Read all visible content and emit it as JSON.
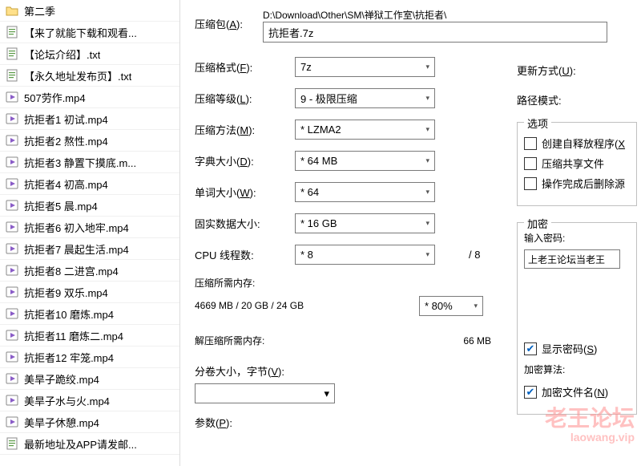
{
  "filelist": {
    "items": [
      {
        "icon": "folder",
        "label": "第二季"
      },
      {
        "icon": "txt",
        "label": "【来了就能下载和观看..."
      },
      {
        "icon": "txt",
        "label": "【论坛介绍】.txt"
      },
      {
        "icon": "txt",
        "label": "【永久地址发布页】.txt"
      },
      {
        "icon": "video",
        "label": "507劳作.mp4"
      },
      {
        "icon": "video",
        "label": "抗拒者1 初试.mp4"
      },
      {
        "icon": "video",
        "label": "抗拒者2 熬性.mp4"
      },
      {
        "icon": "video",
        "label": "抗拒者3 静置下摸底.m..."
      },
      {
        "icon": "video",
        "label": "抗拒者4 初高.mp4"
      },
      {
        "icon": "video",
        "label": "抗拒者5 晨.mp4"
      },
      {
        "icon": "video",
        "label": "抗拒者6 初入地牢.mp4"
      },
      {
        "icon": "video",
        "label": "抗拒者7 晨起生活.mp4"
      },
      {
        "icon": "video",
        "label": "抗拒者8 二进宫.mp4"
      },
      {
        "icon": "video",
        "label": "抗拒者9 双乐.mp4"
      },
      {
        "icon": "video",
        "label": "抗拒者10 磨炼.mp4"
      },
      {
        "icon": "video",
        "label": "抗拒者11 磨炼二.mp4"
      },
      {
        "icon": "video",
        "label": "抗拒者12 牢笼.mp4"
      },
      {
        "icon": "video",
        "label": "美旱子跪绞.mp4"
      },
      {
        "icon": "video",
        "label": "美旱子水与火.mp4"
      },
      {
        "icon": "video",
        "label": "美旱子休憩.mp4"
      },
      {
        "icon": "txt",
        "label": "最新地址及APP请发邮..."
      }
    ]
  },
  "dialog": {
    "archive_label": "压缩包",
    "archive_accel": "A",
    "archive_path": "D:\\Download\\Other\\SM\\禅狱工作室\\抗拒者\\",
    "archive_name": "抗拒者.7z",
    "format_label": "压缩格式",
    "format_accel": "F",
    "format_value": "7z",
    "level_label": "压缩等级",
    "level_accel": "L",
    "level_value": "9 - 极限压缩",
    "method_label": "压缩方法",
    "method_accel": "M",
    "method_value": "* LZMA2",
    "dict_label": "字典大小",
    "dict_accel": "D",
    "dict_value": "* 64 MB",
    "word_label": "单词大小",
    "word_accel": "W",
    "word_value": "* 64",
    "solid_label": "固实数据大小",
    "solid_value": "* 16 GB",
    "threads_label": "CPU 线程数",
    "threads_value": "* 8",
    "threads_total": "/ 8",
    "memc_label": "压缩所需内存",
    "memc_value": "4669 MB / 20 GB / 24 GB",
    "memc_pct": "* 80%",
    "memd_label": "解压缩所需内存",
    "memd_value": "66 MB",
    "vol_label": "分卷大小，字节",
    "vol_accel": "V",
    "params_label": "参数",
    "params_accel": "P",
    "update_label": "更新方式",
    "update_accel": "U",
    "pathmode_label": "路径模式",
    "options_legend": "选项",
    "opt_sfx": "创建自释放程序",
    "opt_sfx_accel": "X",
    "opt_shared": "压缩共享文件",
    "opt_delete": "操作完成后删除源",
    "enc_legend": "加密",
    "enc_pw_label": "输入密码",
    "enc_pw_value": "上老王论坛当老王",
    "enc_showpw": "显示密码",
    "enc_showpw_accel": "S",
    "enc_alg_label": "加密算法",
    "enc_filenames": "加密文件名",
    "enc_filenames_accel": "N"
  },
  "watermark": {
    "line1": "老王论坛",
    "line2": "laowang.vip"
  }
}
